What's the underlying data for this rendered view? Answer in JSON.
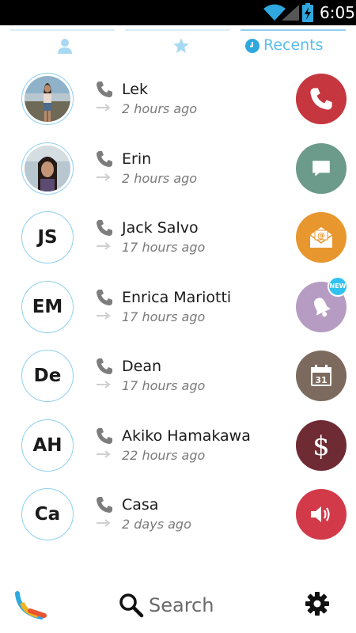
{
  "status_bar": {
    "time": "6:05"
  },
  "tabs": [
    {
      "id": "contacts",
      "label": "",
      "icon": "person-icon"
    },
    {
      "id": "favorites",
      "label": "",
      "icon": "star-icon"
    },
    {
      "id": "recents",
      "label": "Recents",
      "icon": "clock-icon",
      "active": true
    }
  ],
  "recents": [
    {
      "name": "Lek",
      "time": "2 hours ago",
      "avatar": "photo",
      "action": "phone-icon",
      "action_color": "#c5363f"
    },
    {
      "name": "Erin",
      "time": "2 hours ago",
      "avatar": "photo",
      "action": "message-icon",
      "action_color": "#6c9a8b"
    },
    {
      "name": "Jack Salvo",
      "time": "17 hours ago",
      "initials": "JS",
      "action": "email-icon",
      "action_color": "#e8962e"
    },
    {
      "name": "Enrica Mariotti",
      "time": "17 hours ago",
      "initials": "EM",
      "action": "bell-icon",
      "action_color": "#b69cc2",
      "badge": "NEW"
    },
    {
      "name": "Dean",
      "time": "17 hours ago",
      "initials": "De",
      "action": "calendar-icon",
      "action_color": "#7d6a5e",
      "calendar_day": "31"
    },
    {
      "name": "Akiko Hamakawa",
      "time": "22 hours ago",
      "initials": "AH",
      "action": "dollar-icon",
      "action_color": "#6e2b33",
      "symbol": "$"
    },
    {
      "name": "Casa",
      "time": "2 days ago",
      "initials": "Ca",
      "action": "speaker-icon",
      "action_color": "#d23a4a"
    }
  ],
  "bottom_bar": {
    "search_label": "Search"
  },
  "colors": {
    "accent": "#5cbde9",
    "ring": "#8fd0f0"
  }
}
